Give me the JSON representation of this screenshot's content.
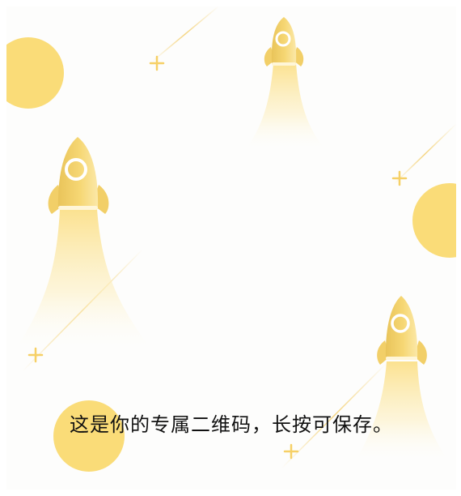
{
  "caption": "这是你的专属二维码，长按可保存。",
  "colors": {
    "circle": "#fadc78",
    "rocket_body": "#f2cf68",
    "rocket_highlight": "#fbe6a0",
    "trail": "#fbe79c",
    "sparkle": "#f6d066",
    "streak": "#f4d174",
    "background": "#fdfdfc"
  },
  "icons": [
    "rocket-icon",
    "circle-decoration",
    "plus-sparkle-icon",
    "light-streak"
  ]
}
